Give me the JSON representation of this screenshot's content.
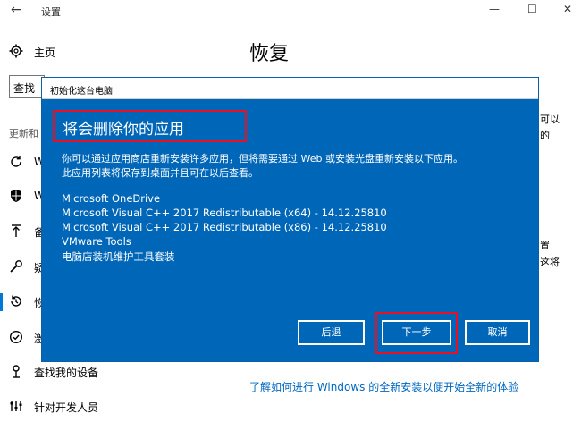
{
  "window": {
    "title": "设置",
    "back_glyph": "←",
    "min_glyph": "—",
    "max_glyph": "☐",
    "close_glyph": "✕"
  },
  "sidebar": {
    "home": "主页",
    "search_fragment": "查找",
    "section_header": "更新和",
    "items": [
      {
        "label": "W",
        "icon": "refresh-icon"
      },
      {
        "label": "W",
        "icon": "shield-icon"
      },
      {
        "label": "备",
        "icon": "backup-arrow-icon"
      },
      {
        "label": "疑",
        "icon": "wrench-icon"
      },
      {
        "label": "恢",
        "icon": "recovery-icon"
      },
      {
        "label": "激",
        "icon": "check-circle-icon"
      },
      {
        "label": "查找我的设备",
        "icon": "find-device-icon"
      },
      {
        "label": "针对开发人员",
        "icon": "developer-icon"
      }
    ]
  },
  "main": {
    "title": "恢复",
    "fragments": [
      "可以",
      "的",
      "置",
      "这将"
    ],
    "link": "了解如何进行 Windows 的全新安装以便开始全新的体验"
  },
  "dialog": {
    "title": "初始化这台电脑",
    "heading": "将会删除你的应用",
    "desc_line1": "你可以通过应用商店重新安装许多应用，但将需要通过 Web 或安装光盘重新安装以下应用。",
    "desc_line2": "此应用列表将保存到桌面并且可在以后查看。",
    "apps": [
      "Microsoft OneDrive",
      "Microsoft Visual C++ 2017 Redistributable (x64) - 14.12.25810",
      "Microsoft Visual C++ 2017 Redistributable (x86) - 14.12.25810",
      "VMware Tools",
      "电脑店装机维护工具套装"
    ],
    "buttons": {
      "back": "后退",
      "next": "下一步",
      "cancel": "取消"
    }
  },
  "colors": {
    "dialog_bg": "#0067b8",
    "highlight": "#e81123",
    "accent": "#0078d7",
    "link": "#0067c0"
  }
}
